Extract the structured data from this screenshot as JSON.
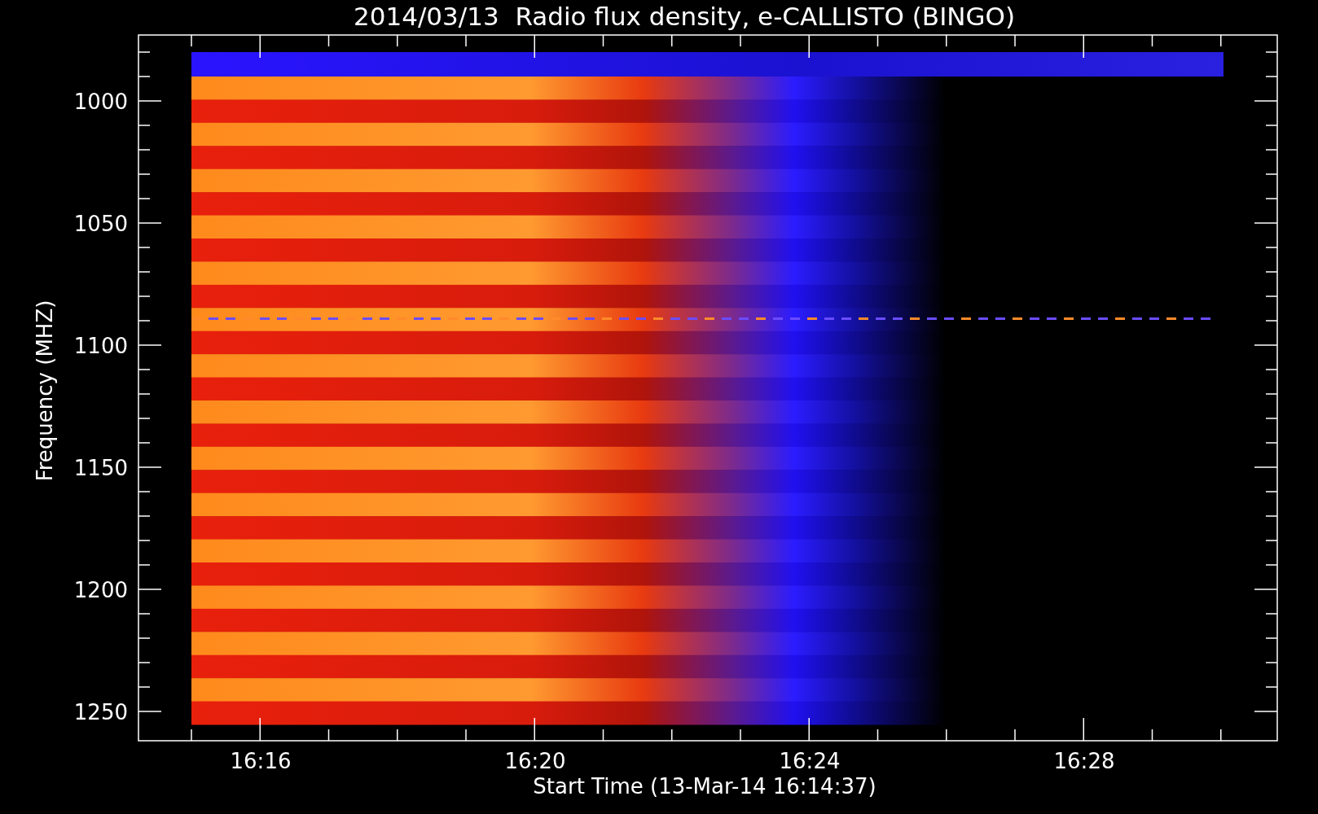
{
  "title": "2014/03/13  Radio flux density, e-CALLISTO (BINGO)",
  "y_axis": {
    "label": "Frequency (MHZ)",
    "ticks": [
      "1000",
      "1050",
      "1100",
      "1150",
      "1200",
      "1250"
    ]
  },
  "x_axis": {
    "label": "Start Time (13-Mar-14 16:14:37)",
    "ticks": [
      "16:16",
      "16:20",
      "16:24",
      "16:28"
    ]
  }
}
